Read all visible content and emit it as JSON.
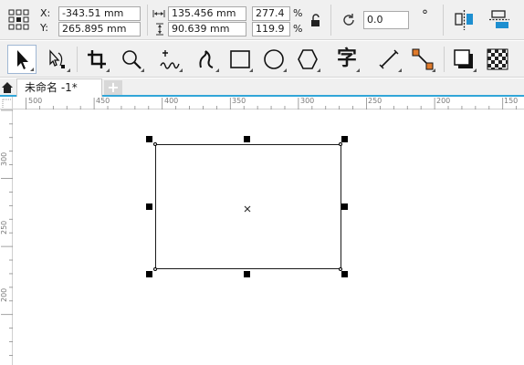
{
  "property_bar": {
    "x_label": "X:",
    "y_label": "Y:",
    "x_value": "-343.51 mm",
    "y_value": "265.895 mm",
    "width_value": "135.456 mm",
    "height_value": "90.639 mm",
    "scale_x_value": "277.4",
    "scale_y_value": "119.9",
    "percent_unit": "%",
    "rotation_value": "0.0",
    "degree_symbol": "°"
  },
  "toolbox": {
    "text_tool_glyph": "字"
  },
  "tabs": {
    "document_name": "未命名 -1*",
    "add_tab_label": "+"
  },
  "rulers": {
    "horizontal_labels": [
      "500",
      "450",
      "400",
      "350",
      "300",
      "250",
      "200",
      "150"
    ],
    "vertical_labels": [
      "300",
      "250",
      "200"
    ]
  },
  "colors": {
    "accent": "#31a6d8",
    "toolbar_bg": "#f0f0f0"
  }
}
